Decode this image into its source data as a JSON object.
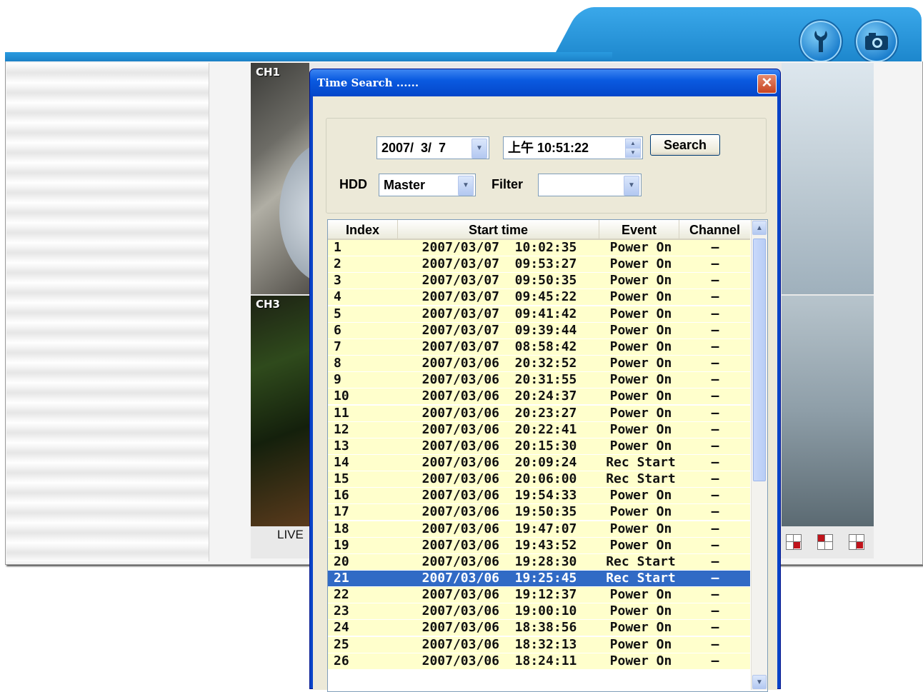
{
  "app": {
    "live_label": "LIVE",
    "channels": [
      "CH1",
      "CH3"
    ],
    "header_icons": [
      "wrench-icon",
      "camera-icon"
    ]
  },
  "dialog": {
    "title": "Time Search ......",
    "close_label": "✕",
    "date_value": "2007/  3/  7",
    "time_value": "上午 10:51:22",
    "search_label": "Search",
    "hdd_label": "HDD",
    "hdd_value": "Master",
    "filter_label": "Filter",
    "filter_value": ""
  },
  "list": {
    "columns": [
      "Index",
      "Start time",
      "Event",
      "Channel"
    ],
    "rows": [
      {
        "index": "1",
        "time": "2007/03/07  10:02:35",
        "event": "Power On",
        "channel": "–"
      },
      {
        "index": "2",
        "time": "2007/03/07  09:53:27",
        "event": "Power On",
        "channel": "–"
      },
      {
        "index": "3",
        "time": "2007/03/07  09:50:35",
        "event": "Power On",
        "channel": "–"
      },
      {
        "index": "4",
        "time": "2007/03/07  09:45:22",
        "event": "Power On",
        "channel": "–"
      },
      {
        "index": "5",
        "time": "2007/03/07  09:41:42",
        "event": "Power On",
        "channel": "–"
      },
      {
        "index": "6",
        "time": "2007/03/07  09:39:44",
        "event": "Power On",
        "channel": "–"
      },
      {
        "index": "7",
        "time": "2007/03/07  08:58:42",
        "event": "Power On",
        "channel": "–"
      },
      {
        "index": "8",
        "time": "2007/03/06  20:32:52",
        "event": "Power On",
        "channel": "–"
      },
      {
        "index": "9",
        "time": "2007/03/06  20:31:55",
        "event": "Power On",
        "channel": "–"
      },
      {
        "index": "10",
        "time": "2007/03/06  20:24:37",
        "event": "Power On",
        "channel": "–"
      },
      {
        "index": "11",
        "time": "2007/03/06  20:23:27",
        "event": "Power On",
        "channel": "–"
      },
      {
        "index": "12",
        "time": "2007/03/06  20:22:41",
        "event": "Power On",
        "channel": "–"
      },
      {
        "index": "13",
        "time": "2007/03/06  20:15:30",
        "event": "Power On",
        "channel": "–"
      },
      {
        "index": "14",
        "time": "2007/03/06  20:09:24",
        "event": "Rec Start",
        "channel": "–"
      },
      {
        "index": "15",
        "time": "2007/03/06  20:06:00",
        "event": "Rec Start",
        "channel": "–"
      },
      {
        "index": "16",
        "time": "2007/03/06  19:54:33",
        "event": "Power On",
        "channel": "–"
      },
      {
        "index": "17",
        "time": "2007/03/06  19:50:35",
        "event": "Power On",
        "channel": "–"
      },
      {
        "index": "18",
        "time": "2007/03/06  19:47:07",
        "event": "Power On",
        "channel": "–"
      },
      {
        "index": "19",
        "time": "2007/03/06  19:43:52",
        "event": "Power On",
        "channel": "–"
      },
      {
        "index": "20",
        "time": "2007/03/06  19:28:30",
        "event": "Rec Start",
        "channel": "–"
      },
      {
        "index": "21",
        "time": "2007/03/06  19:25:45",
        "event": "Rec Start",
        "channel": "–",
        "selected": true
      },
      {
        "index": "22",
        "time": "2007/03/06  19:12:37",
        "event": "Power On",
        "channel": "–"
      },
      {
        "index": "23",
        "time": "2007/03/06  19:00:10",
        "event": "Power On",
        "channel": "–"
      },
      {
        "index": "24",
        "time": "2007/03/06  18:38:56",
        "event": "Power On",
        "channel": "–"
      },
      {
        "index": "25",
        "time": "2007/03/06  18:32:13",
        "event": "Power On",
        "channel": "–"
      },
      {
        "index": "26",
        "time": "2007/03/06  18:24:11",
        "event": "Power On",
        "channel": "–"
      }
    ]
  },
  "colors": {
    "accent": "#1a86d0",
    "dialog_frame": "#0a44c8",
    "row_bg": "#ffffcc",
    "selected_row": "#316ac5"
  }
}
